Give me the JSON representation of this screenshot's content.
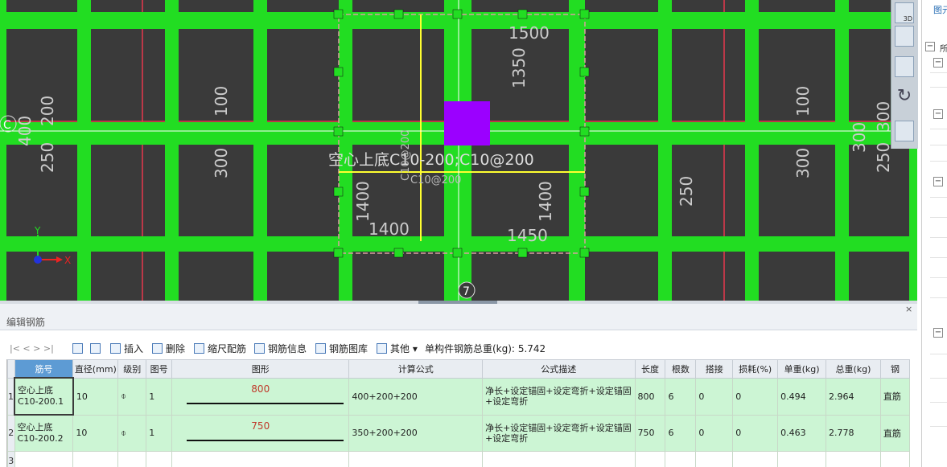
{
  "canvas": {
    "annotations": {
      "main_label": "空心上底C10-200;C10@200",
      "sub_label1": "C10@200",
      "sub_label2": "C10@200",
      "dims": [
        "1500",
        "1350",
        "1400",
        "1400",
        "1400",
        "1450",
        "200",
        "100",
        "400",
        "250",
        "300",
        "250",
        "100",
        "300",
        "300",
        "250",
        "300"
      ]
    },
    "axis_labels": {
      "c": "C",
      "seven": "7",
      "x": "X",
      "y": "Y"
    },
    "colors": {
      "background": "#3a3a3a",
      "beam": "#22dd22",
      "selected": "#9b00ff",
      "grid_red": "#e8384d"
    }
  },
  "view_toolbar": {
    "btn_3d": "3D"
  },
  "right_panel": {
    "title": "图元",
    "tree_root": "所",
    "minus": "−"
  },
  "editor": {
    "title": "编辑钢筋",
    "close": "×",
    "toolbar": {
      "nav": "|<  <  >  >|",
      "insert": "插入",
      "delete": "删除",
      "scale": "缩尺配筋",
      "info": "钢筋信息",
      "library": "钢筋图库",
      "other": "其他",
      "other_arrow": "▾",
      "weight_label": "单构件钢筋总重(kg):",
      "weight_value": "5.742"
    },
    "columns": [
      "筋号",
      "直径(mm)",
      "级别",
      "图号",
      "图形",
      "计算公式",
      "公式描述",
      "长度",
      "根数",
      "搭接",
      "损耗(%)",
      "单重(kg)",
      "总重(kg)",
      "钢"
    ],
    "rows": [
      {
        "n": "1",
        "name_l1": "空心上底",
        "name_l2": "C10-200.1",
        "diameter": "10",
        "grade": "⌽",
        "fig": "1",
        "shape_value": "800",
        "formula": "400+200+200",
        "desc": "净长+设定锚固+设定弯折+设定锚固+设定弯折",
        "length": "800",
        "count": "6",
        "lap": "0",
        "loss": "0",
        "unit_w": "0.494",
        "total_w": "2.964",
        "extra": "直筋"
      },
      {
        "n": "2",
        "name_l1": "空心上底",
        "name_l2": "C10-200.2",
        "diameter": "10",
        "grade": "⌽",
        "fig": "1",
        "shape_value": "750",
        "formula": "350+200+200",
        "desc": "净长+设定锚固+设定弯折+设定锚固+设定弯折",
        "length": "750",
        "count": "6",
        "lap": "0",
        "loss": "0",
        "unit_w": "0.463",
        "total_w": "2.778",
        "extra": "直筋"
      }
    ],
    "row3_num": "3"
  }
}
